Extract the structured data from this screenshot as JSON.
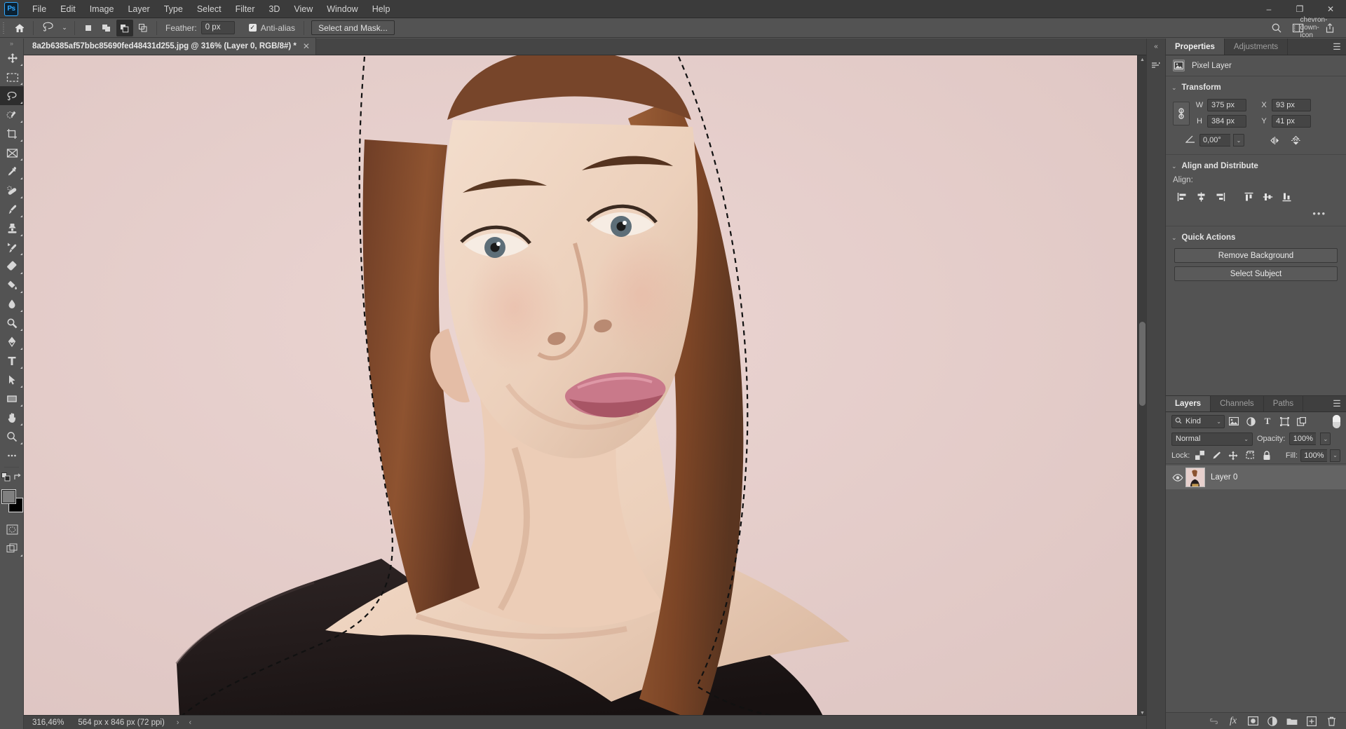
{
  "app": {
    "logo": "Ps",
    "menus": [
      "File",
      "Edit",
      "Image",
      "Layer",
      "Type",
      "Select",
      "Filter",
      "3D",
      "View",
      "Window",
      "Help"
    ],
    "window_controls": {
      "minimize": "–",
      "restore": "❐",
      "close": "✕"
    }
  },
  "options_bar": {
    "home_icon": "home-icon",
    "tool_icon": "lasso-tool-icon",
    "tool_caret": "⌄",
    "selection_modes": [
      "new-selection",
      "add-to-selection",
      "subtract-from-selection",
      "intersect-with-selection"
    ],
    "active_selection_mode": "subtract-from-selection",
    "feather_label": "Feather:",
    "feather_value": "0 px",
    "antialias_label": "Anti-alias",
    "antialias_checked": true,
    "select_and_mask_label": "Select and Mask...",
    "right_icons": [
      "search-icon",
      "workspace-icon",
      "chevron-down-icon",
      "share-icon"
    ]
  },
  "toolbar": {
    "tools": [
      {
        "name": "move-tool",
        "glyph": "move"
      },
      {
        "name": "rectangular-marquee-tool",
        "glyph": "marquee"
      },
      {
        "name": "lasso-tool",
        "glyph": "lasso",
        "active": true
      },
      {
        "name": "object-selection-tool",
        "glyph": "quickselect"
      },
      {
        "name": "crop-tool",
        "glyph": "crop"
      },
      {
        "name": "frame-tool",
        "glyph": "frame"
      },
      {
        "name": "eyedropper-tool",
        "glyph": "eyedropper"
      },
      {
        "name": "spot-healing-brush-tool",
        "glyph": "healing"
      },
      {
        "name": "brush-tool",
        "glyph": "brush"
      },
      {
        "name": "clone-stamp-tool",
        "glyph": "stamp"
      },
      {
        "name": "history-brush-tool",
        "glyph": "historybrush"
      },
      {
        "name": "eraser-tool",
        "glyph": "eraser"
      },
      {
        "name": "gradient-tool",
        "glyph": "paintbucket"
      },
      {
        "name": "blur-tool",
        "glyph": "blur"
      },
      {
        "name": "dodge-tool",
        "glyph": "dodge"
      },
      {
        "name": "pen-tool",
        "glyph": "pen"
      },
      {
        "name": "horizontal-type-tool",
        "glyph": "type"
      },
      {
        "name": "path-selection-tool",
        "glyph": "pathselect"
      },
      {
        "name": "rectangle-tool",
        "glyph": "rectangle"
      },
      {
        "name": "hand-tool",
        "glyph": "hand"
      },
      {
        "name": "zoom-tool",
        "glyph": "zoom"
      },
      {
        "name": "edit-toolbar-tool",
        "glyph": "ellipsis"
      }
    ],
    "color_mode_icons": [
      "default-colors-icon",
      "swap-colors-icon"
    ],
    "foreground_color": "#808080",
    "background_color": "#000000",
    "quick_mask_icon": "quick-mask-icon",
    "screen_mode_icon": "screen-mode-icon"
  },
  "document": {
    "tab_title": "8a2b6385af57bbc85690fed48431d255.jpg @ 316% (Layer 0, RGB/8#) *",
    "close_glyph": "✕"
  },
  "status_bar": {
    "zoom": "316,46%",
    "doc_size": "564 px x 846 px (72 ppi)",
    "next_arrow": "›",
    "prev_arrow": "‹"
  },
  "right_rail": {
    "collapse_glyph": "«",
    "icons": [
      "history-panel-icon"
    ]
  },
  "properties_panel": {
    "tabs": [
      {
        "label": "Properties",
        "active": true
      },
      {
        "label": "Adjustments",
        "active": false
      }
    ],
    "menu_glyph": "☰",
    "layer_kind_icon": "pixel-layer-icon",
    "layer_kind_label": "Pixel Layer",
    "transform": {
      "title": "Transform",
      "collapse_glyph": "⌄",
      "link_icon": "link-aspect-ratio-icon",
      "w_label": "W",
      "w_value": "375 px",
      "h_label": "H",
      "h_value": "384 px",
      "x_label": "X",
      "x_value": "93 px",
      "y_label": "Y",
      "y_value": "41 px",
      "angle_icon": "angle-icon",
      "angle_value": "0,00°",
      "angle_caret": "⌄",
      "flip_horizontal_icon": "flip-horizontal-icon",
      "flip_vertical_icon": "flip-vertical-icon"
    },
    "align": {
      "title": "Align and Distribute",
      "collapse_glyph": "⌄",
      "label": "Align:",
      "buttons": [
        "align-left-edges-icon",
        "align-horizontal-centers-icon",
        "align-right-edges-icon",
        "align-top-edges-icon",
        "align-vertical-centers-icon",
        "align-bottom-edges-icon"
      ],
      "more_glyph": "•••"
    },
    "quick_actions": {
      "title": "Quick Actions",
      "collapse_glyph": "⌄",
      "buttons": [
        "Remove Background",
        "Select Subject"
      ]
    }
  },
  "layers_panel": {
    "tabs": [
      {
        "label": "Layers",
        "active": true
      },
      {
        "label": "Channels",
        "active": false
      },
      {
        "label": "Paths",
        "active": false
      }
    ],
    "menu_glyph": "☰",
    "filter": {
      "search_icon": "search-icon",
      "kind_label": "Kind",
      "caret": "⌄",
      "type_icons": [
        "filter-pixel-icon",
        "filter-adjustment-icon",
        "filter-type-icon",
        "filter-shape-icon",
        "filter-smart-object-icon"
      ],
      "toggle_icon": "filter-toggle-icon"
    },
    "blend_mode": "Normal",
    "blend_caret": "⌄",
    "opacity_label": "Opacity:",
    "opacity_value": "100%",
    "lock_label": "Lock:",
    "lock_icons": [
      "lock-transparent-pixels-icon",
      "lock-image-pixels-icon",
      "lock-position-icon",
      "lock-artboard-nesting-icon",
      "lock-all-icon"
    ],
    "fill_label": "Fill:",
    "fill_value": "100%",
    "layers": [
      {
        "name": "Layer 0",
        "visible": true,
        "visibility_icon": "eye-icon",
        "selected": true
      }
    ],
    "footer_icons": [
      "link-layers-icon",
      "layer-style-fx-icon",
      "add-layer-mask-icon",
      "new-fill-adjustment-layer-icon",
      "new-group-icon",
      "new-layer-icon",
      "delete-layer-icon"
    ]
  },
  "canvas": {
    "background_color": "#e7d0cd",
    "selection_active": true,
    "subject": "portrait-photo-of-woman"
  }
}
